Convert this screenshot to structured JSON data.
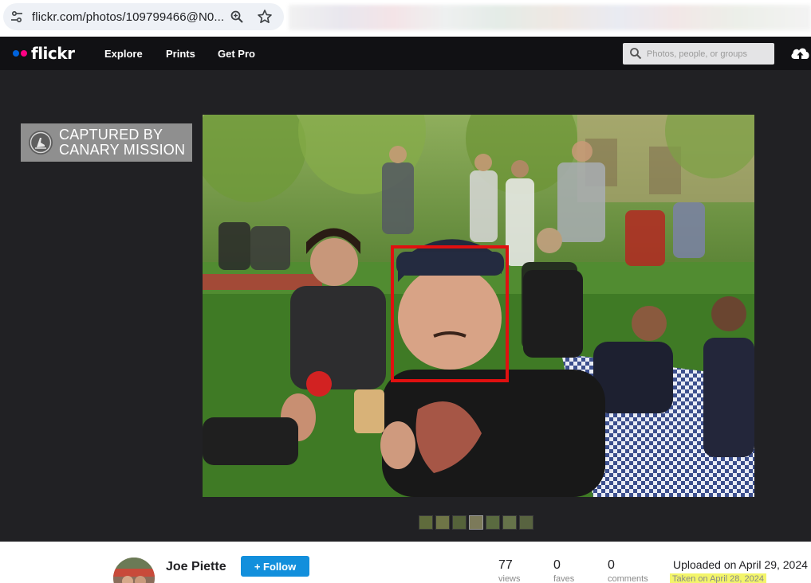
{
  "browser": {
    "url": "flickr.com/photos/109799466@N0..."
  },
  "nav": {
    "logo": "flickr",
    "links": [
      "Explore",
      "Prints",
      "Get Pro"
    ],
    "search_placeholder": "Photos, people, or groups"
  },
  "watermark": {
    "line1": "CAPTURED BY",
    "line2": "CANARY MISSION"
  },
  "photo": {
    "highlight_color": "#e01010"
  },
  "owner": {
    "name": "Joe Piette",
    "follow_label": "+ Follow"
  },
  "stats": [
    {
      "value": "77",
      "label": "views"
    },
    {
      "value": "0",
      "label": "faves"
    },
    {
      "value": "0",
      "label": "comments"
    }
  ],
  "dates": {
    "uploaded": "Uploaded on April 29, 2024",
    "taken": "Taken on April 28, 2024"
  },
  "colors": {
    "flickr_blue": "#0063dc",
    "flickr_pink": "#ff0084",
    "follow_button": "#128fdc",
    "taken_highlight": "#f3f56a"
  }
}
